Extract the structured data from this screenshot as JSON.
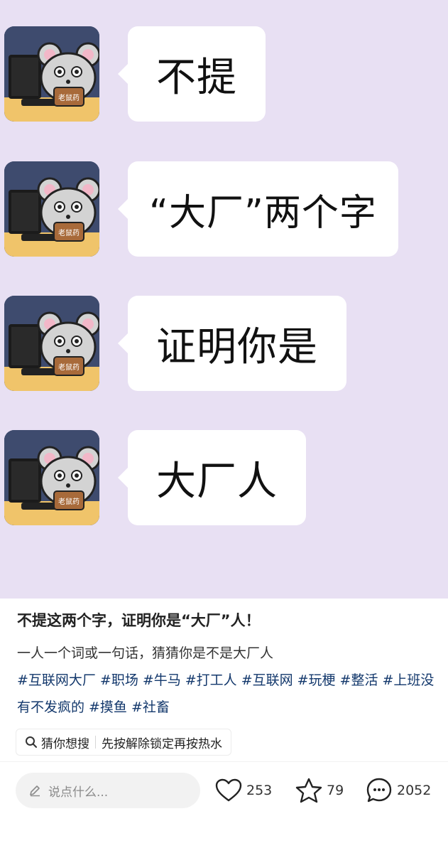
{
  "bubbles": [
    {
      "text": "不提"
    },
    {
      "text": "“大厂”两个字"
    },
    {
      "text": "证明你是"
    },
    {
      "text": "大厂人"
    }
  ],
  "avatar": {
    "mug_label": "老鼠药"
  },
  "post": {
    "title": "不提这两个字，证明你是“大厂”人！",
    "description": "一人一个词或一句话，猜猜你是不是大厂人",
    "tags": [
      "#互联网大厂",
      "#职场",
      "#牛马",
      "#打工人",
      "#互联网",
      "#玩梗",
      "#整活",
      "#上班没有不发疯的",
      "#摸鱼",
      "#社畜"
    ]
  },
  "search_chip": {
    "label": "猜你想搜",
    "query": "先按解除锁定再按热水"
  },
  "comment": {
    "placeholder": "说点什么..."
  },
  "actions": {
    "likes": "253",
    "favorites": "79",
    "comments": "2052"
  },
  "colors": {
    "background": "#e8e0f3",
    "tag": "#13386c"
  }
}
